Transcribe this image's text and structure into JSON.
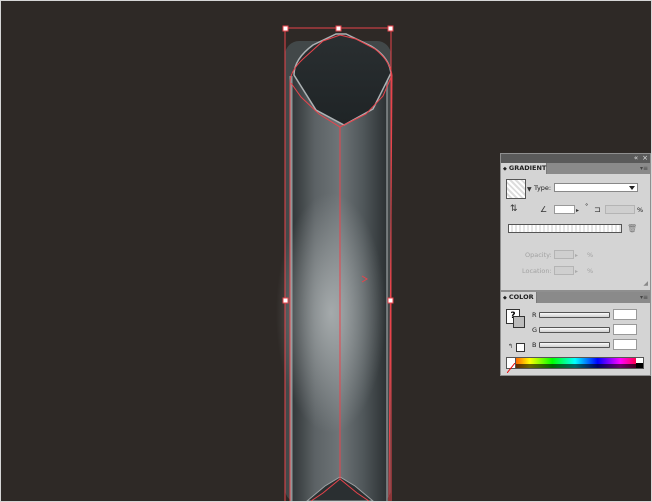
{
  "gradient_panel": {
    "title": "GRADIENT",
    "type_label": "Type:",
    "type_value": "",
    "angle_value": "",
    "degree_symbol": "°",
    "aspect_value": "",
    "percent_symbol": "%",
    "opacity_label": "Opacity:",
    "opacity_value": "",
    "location_label": "Location:",
    "location_value": ""
  },
  "color_panel": {
    "title": "COLOR",
    "channels": [
      {
        "label": "R",
        "value": ""
      },
      {
        "label": "G",
        "value": ""
      },
      {
        "label": "B",
        "value": ""
      }
    ]
  },
  "colors": {
    "canvas_bg": "#2e2926",
    "selection": "#e8434b",
    "panel_bg": "#d4d4d4",
    "panel_header": "#5a5a5a"
  },
  "icons": [
    "collapse-icon",
    "close-icon",
    "panel-menu-icon",
    "reverse-gradient-icon",
    "angle-icon",
    "aspect-ratio-icon",
    "delete-stop-icon",
    "out-of-gamut-icon",
    "fill-stroke-icon"
  ]
}
